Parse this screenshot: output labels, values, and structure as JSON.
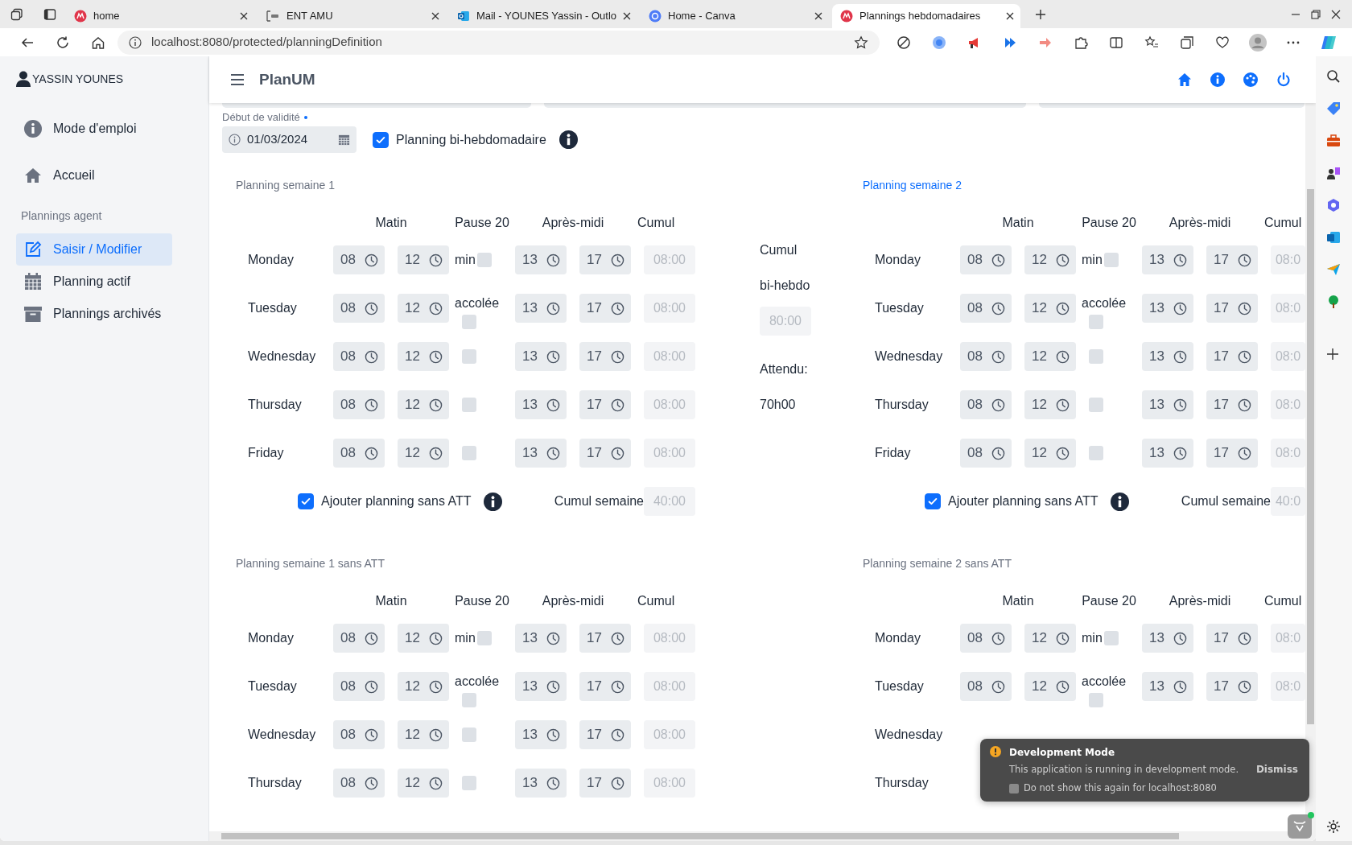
{
  "browser": {
    "tabs": [
      {
        "title": "home",
        "selected": false
      },
      {
        "title": "ENT AMU",
        "selected": false
      },
      {
        "title": "Mail - YOUNES Yassin - Outlo",
        "selected": false
      },
      {
        "title": "Home - Canva",
        "selected": false
      },
      {
        "title": "Plannings hebdomadaires",
        "selected": true
      }
    ],
    "address": "localhost:8080/protected/planningDefinition"
  },
  "sidebar": {
    "user": "YASSIN YOUNES",
    "items": [
      {
        "label": "Mode d'emploi",
        "selected": false
      },
      {
        "label": "Accueil",
        "selected": false
      }
    ],
    "sections": [
      {
        "title": "Plannings agent",
        "items": [
          {
            "label": "Saisir / Modifier",
            "selected": true
          },
          {
            "label": "Planning actif",
            "selected": false
          },
          {
            "label": "Plannings archivés",
            "selected": false
          }
        ]
      }
    ]
  },
  "header": {
    "title": "PlanUM"
  },
  "form": {
    "validity": {
      "label": "Début de validité",
      "required": true,
      "value": "01/03/2024"
    },
    "biweekly": {
      "label": "Planning bi-hebdomadaire",
      "checked": true
    }
  },
  "biweekly_total": {
    "label_lines": [
      "Cumul",
      "bi-hebdo"
    ],
    "value": "80:00",
    "expected_label": "Attendu:",
    "expected": "70h00"
  },
  "weeks": [
    {
      "title": "Planning semaine 1",
      "highlighted": false,
      "columns": {
        "morning": "Matin",
        "pause": [
          "Pause 20",
          "min",
          "accolée"
        ],
        "afternoon": "Après-midi",
        "total": "Cumul"
      },
      "rows": [
        {
          "day": "Monday",
          "times": [
            "08",
            "12",
            "13",
            "17"
          ],
          "pause": false,
          "total": "08:00"
        },
        {
          "day": "Tuesday",
          "times": [
            "08",
            "12",
            "13",
            "17"
          ],
          "pause": false,
          "total": "08:00"
        },
        {
          "day": "Wednesday",
          "times": [
            "08",
            "12",
            "13",
            "17"
          ],
          "pause": false,
          "total": "08:00"
        },
        {
          "day": "Thursday",
          "times": [
            "08",
            "12",
            "13",
            "17"
          ],
          "pause": false,
          "total": "08:00"
        },
        {
          "day": "Friday",
          "times": [
            "08",
            "12",
            "13",
            "17"
          ],
          "pause": false,
          "total": "08:00"
        }
      ],
      "footer": {
        "label": "Ajouter planning sans ATT",
        "checked": true,
        "total_label": "Cumul semaine",
        "total": "40:00"
      }
    },
    {
      "title": "Planning semaine 2",
      "highlighted": true,
      "columns": {
        "morning": "Matin",
        "pause": [
          "Pause 20",
          "min",
          "accolée"
        ],
        "afternoon": "Après-midi",
        "total": "Cumul"
      },
      "rows": [
        {
          "day": "Monday",
          "times": [
            "08",
            "12",
            "13",
            "17"
          ],
          "pause": false,
          "total": "08:0"
        },
        {
          "day": "Tuesday",
          "times": [
            "08",
            "12",
            "13",
            "17"
          ],
          "pause": false,
          "total": "08:0"
        },
        {
          "day": "Wednesday",
          "times": [
            "08",
            "12",
            "13",
            "17"
          ],
          "pause": false,
          "total": "08:0"
        },
        {
          "day": "Thursday",
          "times": [
            "08",
            "12",
            "13",
            "17"
          ],
          "pause": false,
          "total": "08:0"
        },
        {
          "day": "Friday",
          "times": [
            "08",
            "12",
            "13",
            "17"
          ],
          "pause": false,
          "total": "08:0"
        }
      ],
      "footer": {
        "label": "Ajouter planning sans ATT",
        "checked": true,
        "total_label": "Cumul semaine",
        "total": "40:0"
      }
    },
    {
      "title": "Planning semaine 1 sans ATT",
      "highlighted": false,
      "columns": {
        "morning": "Matin",
        "pause": [
          "Pause 20",
          "min",
          "accolée"
        ],
        "afternoon": "Après-midi",
        "total": "Cumul"
      },
      "rows": [
        {
          "day": "Monday",
          "times": [
            "08",
            "12",
            "13",
            "17"
          ],
          "pause": false,
          "total": "08:00"
        },
        {
          "day": "Tuesday",
          "times": [
            "08",
            "12",
            "13",
            "17"
          ],
          "pause": false,
          "total": "08:00"
        },
        {
          "day": "Wednesday",
          "times": [
            "08",
            "12",
            "13",
            "17"
          ],
          "pause": false,
          "total": "08:00"
        },
        {
          "day": "Thursday",
          "times": [
            "08",
            "12",
            "13",
            "17"
          ],
          "pause": false,
          "total": "08:00"
        }
      ]
    },
    {
      "title": "Planning semaine 2 sans ATT",
      "highlighted": false,
      "columns": {
        "morning": "Matin",
        "pause": [
          "Pause 20",
          "min",
          "accolée"
        ],
        "afternoon": "Après-midi",
        "total": "Cumul"
      },
      "rows": [
        {
          "day": "Monday",
          "times": [
            "08",
            "12",
            "13",
            "17"
          ],
          "pause": false,
          "total": "08:0"
        },
        {
          "day": "Tuesday",
          "times": [
            "08",
            "12",
            "13",
            "17"
          ],
          "pause": false,
          "total": "08:0"
        },
        {
          "day": "Wednesday"
        },
        {
          "day": "Thursday"
        }
      ]
    }
  ],
  "dev_toast": {
    "title": "Development Mode",
    "message": "This application is running in development mode.",
    "dismiss": "Dismiss",
    "option": {
      "label": "Do not show this again for localhost:8080",
      "checked": false
    }
  }
}
